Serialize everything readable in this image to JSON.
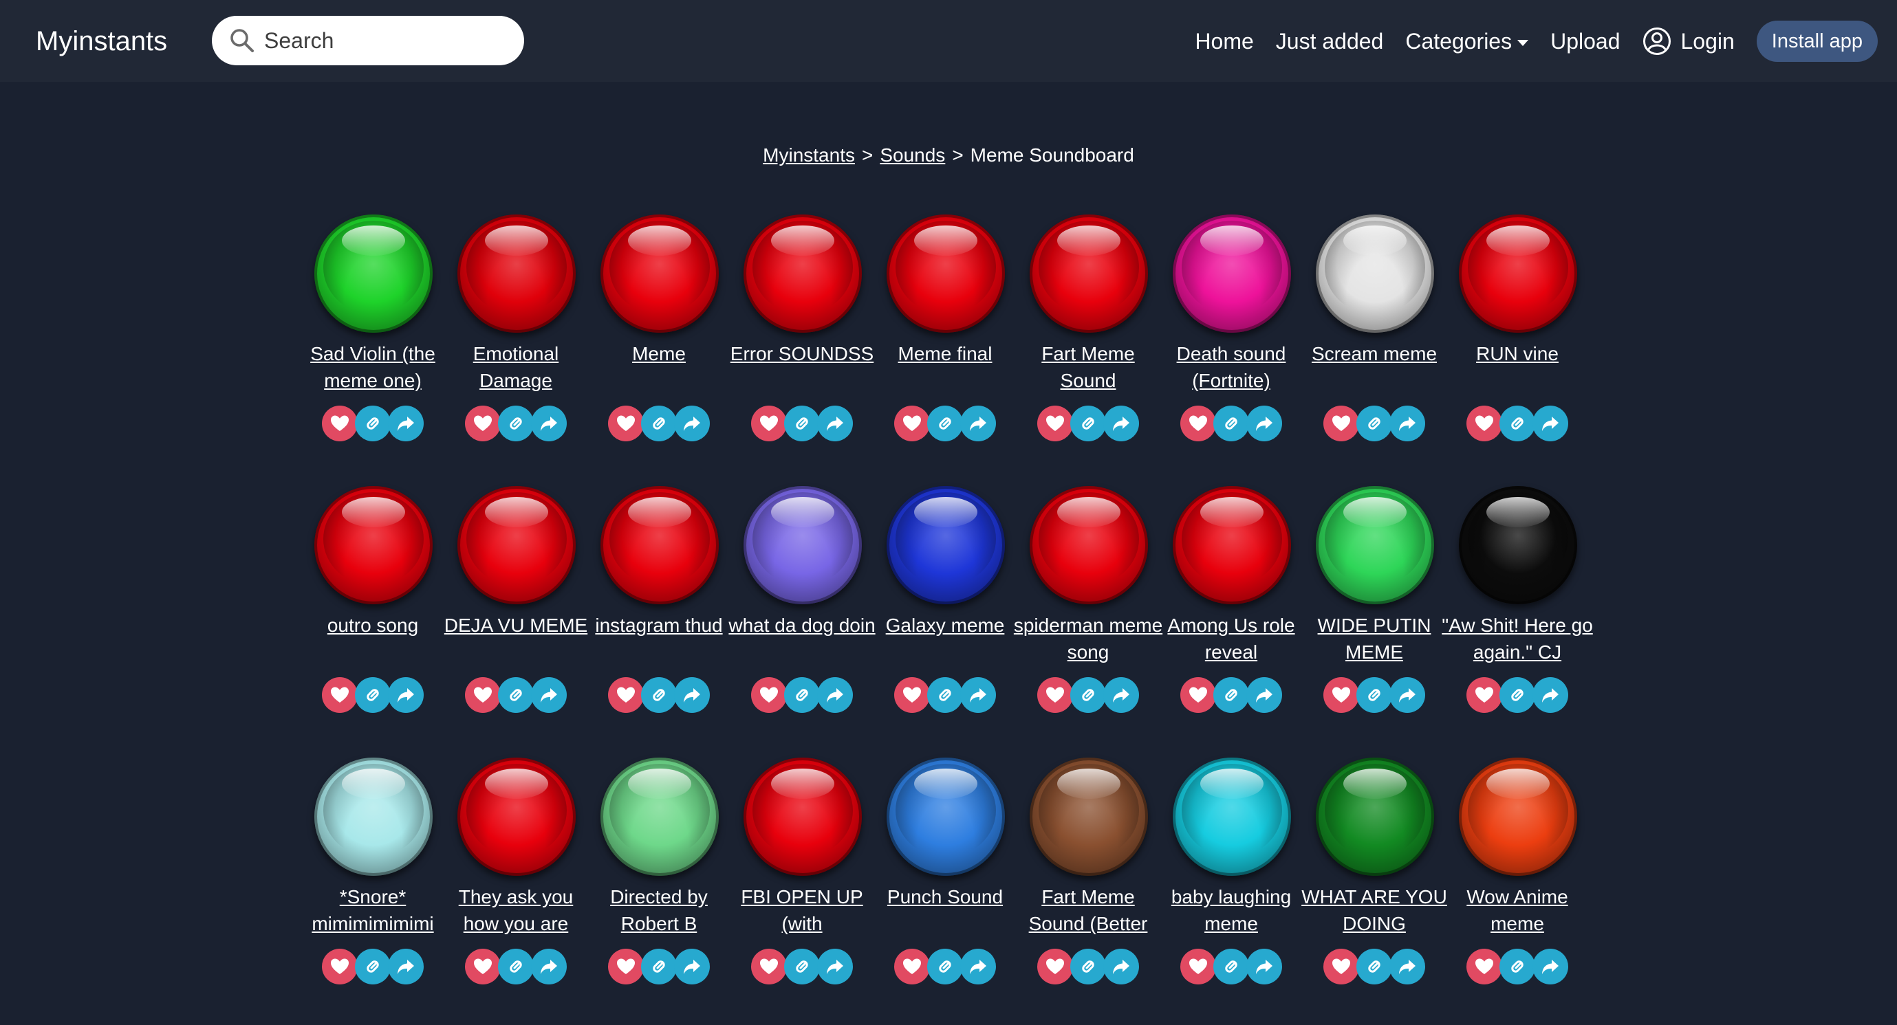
{
  "navbar": {
    "brand": "Myinstants",
    "search_placeholder": "Search",
    "links": {
      "home": "Home",
      "just_added": "Just added",
      "categories": "Categories",
      "upload": "Upload",
      "login": "Login"
    },
    "install_label": "Install app"
  },
  "breadcrumb": {
    "root": "Myinstants",
    "sounds": "Sounds",
    "current": "Meme Soundboard",
    "separator": ">"
  },
  "colors": {
    "background": "#1a2130",
    "navbar": "#212836",
    "favorite": "#e14a62",
    "action": "#27a9cf",
    "install": "#3e5780"
  },
  "sounds": [
    {
      "label": "Sad Violin (the meme one)",
      "color": "#1ed32a"
    },
    {
      "label": "Emotional Damage",
      "color": "#e0000a"
    },
    {
      "label": "Meme",
      "color": "#e8000c"
    },
    {
      "label": "Error SOUNDSS",
      "color": "#e8000c"
    },
    {
      "label": "Meme final",
      "color": "#e8000c"
    },
    {
      "label": "Fart Meme Sound",
      "color": "#e8000c"
    },
    {
      "label": "Death sound (Fortnite)",
      "color": "#ee129a"
    },
    {
      "label": "Scream meme",
      "color": "#e4e4e4"
    },
    {
      "label": "RUN vine",
      "color": "#e8000c"
    },
    {
      "label": "outro song",
      "color": "#e8000c"
    },
    {
      "label": "DEJA VU MEME",
      "color": "#e8000c"
    },
    {
      "label": "instagram thud",
      "color": "#e8000c"
    },
    {
      "label": "what da dog doin",
      "color": "#7866e6"
    },
    {
      "label": "Galaxy meme",
      "color": "#1e36d8"
    },
    {
      "label": "spiderman meme song",
      "color": "#e8000c"
    },
    {
      "label": "Among Us role reveal",
      "color": "#e8000c"
    },
    {
      "label": "WIDE PUTIN MEME",
      "color": "#2ed658"
    },
    {
      "label": "\"Aw Shit! Here go again.\" CJ",
      "color": "#0c0c0c"
    },
    {
      "label": "*Snore* mimimimimimi",
      "color": "#a8e8ea"
    },
    {
      "label": "They ask you how you are",
      "color": "#e8000c"
    },
    {
      "label": "Directed by Robert B",
      "color": "#6ed88a"
    },
    {
      "label": "FBI OPEN UP (with",
      "color": "#e8000c"
    },
    {
      "label": "Punch Sound",
      "color": "#2e7ee0"
    },
    {
      "label": "Fart Meme Sound (Better",
      "color": "#8a5030"
    },
    {
      "label": "baby laughing meme",
      "color": "#16cce0"
    },
    {
      "label": "WHAT ARE YOU DOING",
      "color": "#128a22"
    },
    {
      "label": "Wow Anime meme",
      "color": "#ec3e10"
    }
  ]
}
